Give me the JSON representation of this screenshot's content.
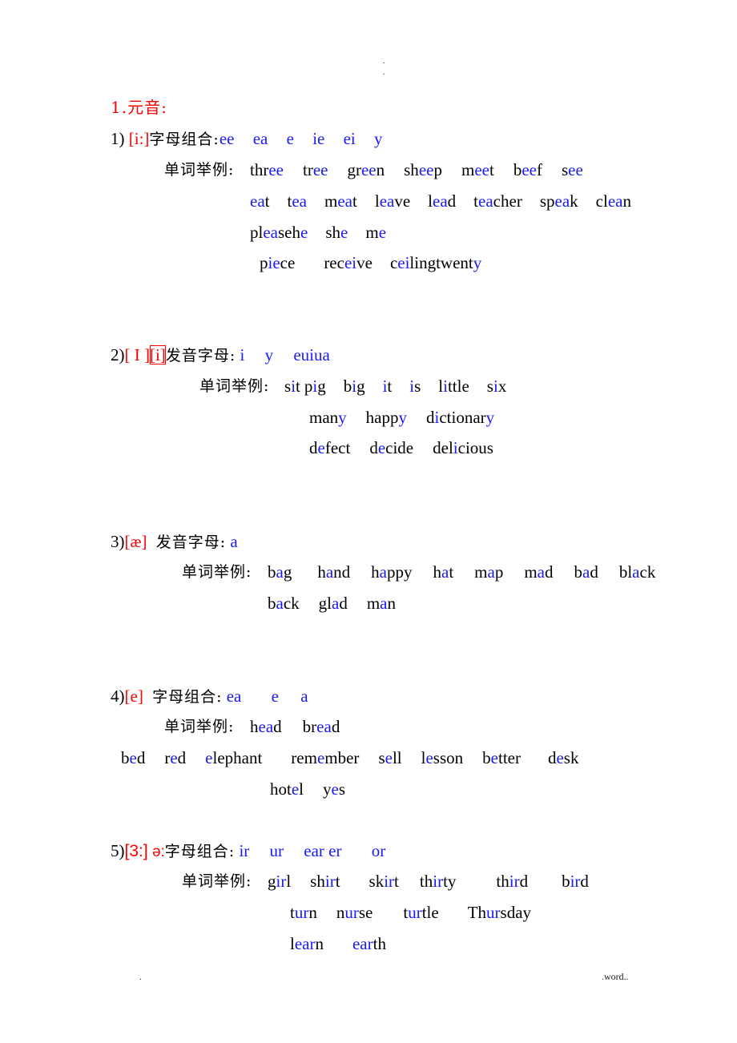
{
  "header_marks": [
    ".",
    "."
  ],
  "title": "1.元音:",
  "colors": {
    "accent_red": "#ff0000",
    "accent_blue": "#1a1aff",
    "text": "#000000"
  },
  "sections": [
    {
      "num": "1)",
      "phonetic": "[i:]",
      "phonetic_extra": "",
      "rule_label": "字母组合:",
      "letters": [
        "ee",
        "ea",
        "e",
        "ie",
        "ei",
        "y"
      ],
      "examples_label": "单词举例:",
      "rows": [
        [
          [
            [
              "thr",
              "k"
            ],
            [
              "ee",
              "b"
            ]
          ],
          [
            [
              "tr",
              "k"
            ],
            [
              "ee",
              "b"
            ]
          ],
          [
            [
              "gr",
              "k"
            ],
            [
              "ee",
              "b"
            ],
            [
              "n",
              "k"
            ]
          ],
          [
            [
              "sh",
              "k"
            ],
            [
              "ee",
              "b"
            ],
            [
              "p",
              "k"
            ]
          ],
          [
            [
              "m",
              "k"
            ],
            [
              "ee",
              "b"
            ],
            [
              "t",
              "k"
            ]
          ],
          [
            [
              "b",
              "k"
            ],
            [
              "ee",
              "b"
            ],
            [
              "f",
              "k"
            ]
          ],
          [
            [
              "s",
              "k"
            ],
            [
              "ee",
              "b"
            ]
          ]
        ],
        [
          [
            [
              "ea",
              "b"
            ],
            [
              "t",
              "k"
            ]
          ],
          [
            [
              "t",
              "k"
            ],
            [
              "ea",
              "b"
            ]
          ],
          [
            [
              "m",
              "k"
            ],
            [
              "ea",
              "b"
            ],
            [
              "t",
              "k"
            ]
          ],
          [
            [
              "l",
              "k"
            ],
            [
              "ea",
              "b"
            ],
            [
              "ve",
              "k"
            ]
          ],
          [
            [
              "l",
              "k"
            ],
            [
              "ea",
              "b"
            ],
            [
              "d",
              "k"
            ]
          ],
          [
            [
              "t",
              "k"
            ],
            [
              "ea",
              "b"
            ],
            [
              "cher",
              "k"
            ]
          ],
          [
            [
              "sp",
              "k"
            ],
            [
              "ea",
              "b"
            ],
            [
              "k",
              "k"
            ]
          ],
          [
            [
              "cl",
              "k"
            ],
            [
              "ea",
              "b"
            ],
            [
              "n",
              "k"
            ]
          ]
        ],
        [
          [
            [
              "pl",
              "k"
            ],
            [
              "ea",
              "b"
            ],
            [
              "seh",
              "k"
            ],
            [
              "e",
              "b"
            ]
          ],
          [
            [
              "sh",
              "k"
            ],
            [
              "e",
              "b"
            ]
          ],
          [
            [
              "m",
              "k"
            ],
            [
              "e",
              "b"
            ]
          ]
        ],
        [
          [
            [
              "p",
              "k"
            ],
            [
              "ie",
              "b"
            ],
            [
              "ce",
              "k"
            ]
          ],
          [
            [
              "rec",
              "k"
            ],
            [
              "ei",
              "b"
            ],
            [
              "ve",
              "k"
            ]
          ],
          [
            [
              "c",
              "k"
            ],
            [
              "ei",
              "b"
            ],
            [
              "ling",
              "k"
            ]
          ],
          [
            [
              "twent",
              "k"
            ],
            [
              "y",
              "b"
            ]
          ]
        ]
      ]
    },
    {
      "num": "2)",
      "phonetic": "[ I ]",
      "phonetic_extra": "[i]",
      "rule_label": "发音字母:",
      "letters": [
        "i",
        "y",
        "euiua"
      ],
      "examples_label": "单词举例:",
      "rows": [
        [
          [
            [
              "s",
              "k"
            ],
            [
              "i",
              "b"
            ],
            [
              "t",
              "k"
            ]
          ],
          [
            [
              "p",
              "k"
            ],
            [
              "i",
              "b"
            ],
            [
              "g",
              "k"
            ]
          ],
          [
            [
              "b",
              "k"
            ],
            [
              "i",
              "b"
            ],
            [
              "g",
              "k"
            ]
          ],
          [
            [
              "i",
              "b"
            ],
            [
              "t",
              "k"
            ]
          ],
          [
            [
              "i",
              "b"
            ],
            [
              "s",
              "k"
            ]
          ],
          [
            [
              "l",
              "k"
            ],
            [
              "i",
              "b"
            ],
            [
              "ttle",
              "k"
            ]
          ],
          [
            [
              "s",
              "k"
            ],
            [
              "i",
              "b"
            ],
            [
              "x",
              "k"
            ]
          ]
        ],
        [
          [
            [
              "man",
              "k"
            ],
            [
              "y",
              "b"
            ]
          ],
          [
            [
              "happ",
              "k"
            ],
            [
              "y",
              "b"
            ]
          ],
          [
            [
              "d",
              "k"
            ],
            [
              "i",
              "b"
            ],
            [
              "ctionar",
              "k"
            ],
            [
              "y",
              "b"
            ]
          ]
        ],
        [
          [
            [
              "d",
              "k"
            ],
            [
              "e",
              "b"
            ],
            [
              "fect",
              "k"
            ]
          ],
          [
            [
              "d",
              "k"
            ],
            [
              "e",
              "b"
            ],
            [
              "cide",
              "k"
            ]
          ],
          [
            [
              "del",
              "k"
            ],
            [
              "i",
              "b"
            ],
            [
              "cious",
              "k"
            ]
          ]
        ]
      ]
    },
    {
      "num": "3)",
      "phonetic": "[æ]",
      "phonetic_extra": "",
      "rule_label": "发音字母:",
      "letters": [
        "a"
      ],
      "examples_label": "单词举例:",
      "rows": [
        [
          [
            [
              "b",
              "k"
            ],
            [
              "a",
              "b"
            ],
            [
              "g",
              "k"
            ]
          ],
          [
            [
              "h",
              "k"
            ],
            [
              "a",
              "b"
            ],
            [
              "nd",
              "k"
            ]
          ],
          [
            [
              "h",
              "k"
            ],
            [
              "a",
              "b"
            ],
            [
              "ppy",
              "k"
            ]
          ],
          [
            [
              "h",
              "k"
            ],
            [
              "a",
              "b"
            ],
            [
              "t",
              "k"
            ]
          ],
          [
            [
              "m",
              "k"
            ],
            [
              "a",
              "b"
            ],
            [
              "p",
              "k"
            ]
          ],
          [
            [
              "m",
              "k"
            ],
            [
              "a",
              "b"
            ],
            [
              "d",
              "k"
            ]
          ],
          [
            [
              "b",
              "k"
            ],
            [
              "a",
              "b"
            ],
            [
              "d",
              "k"
            ]
          ],
          [
            [
              "bl",
              "k"
            ],
            [
              "a",
              "b"
            ],
            [
              "ck",
              "k"
            ]
          ]
        ],
        [
          [
            [
              "b",
              "k"
            ],
            [
              "a",
              "b"
            ],
            [
              "ck",
              "k"
            ]
          ],
          [
            [
              "gl",
              "k"
            ],
            [
              "a",
              "b"
            ],
            [
              "d",
              "k"
            ]
          ],
          [
            [
              "m",
              "k"
            ],
            [
              "a",
              "b"
            ],
            [
              "n",
              "k"
            ]
          ]
        ]
      ]
    },
    {
      "num": "4)",
      "phonetic": "[e]",
      "phonetic_extra": "",
      "rule_label": "字母组合:",
      "letters": [
        "ea",
        "e",
        "a"
      ],
      "examples_label": "单词举例:",
      "rows": [
        [
          [
            [
              "h",
              "k"
            ],
            [
              "ea",
              "b"
            ],
            [
              "d",
              "k"
            ]
          ],
          [
            [
              "br",
              "k"
            ],
            [
              "ea",
              "b"
            ],
            [
              "d",
              "k"
            ]
          ]
        ],
        [
          [
            [
              "b",
              "k"
            ],
            [
              "e",
              "b"
            ],
            [
              "d",
              "k"
            ]
          ],
          [
            [
              "r",
              "k"
            ],
            [
              "e",
              "b"
            ],
            [
              "d",
              "k"
            ]
          ],
          [
            [
              "e",
              "b"
            ],
            [
              "lephant",
              "k"
            ]
          ],
          [
            [
              "rem",
              "k"
            ],
            [
              "e",
              "b"
            ],
            [
              "mber",
              "k"
            ]
          ],
          [
            [
              "s",
              "k"
            ],
            [
              "e",
              "b"
            ],
            [
              "ll",
              "k"
            ]
          ],
          [
            [
              "l",
              "k"
            ],
            [
              "e",
              "b"
            ],
            [
              "sson",
              "k"
            ]
          ],
          [
            [
              "b",
              "k"
            ],
            [
              "e",
              "b"
            ],
            [
              "tter",
              "k"
            ]
          ],
          [
            [
              "d",
              "k"
            ],
            [
              "e",
              "b"
            ],
            [
              "sk",
              "k"
            ]
          ]
        ],
        [
          [
            [
              "hot",
              "k"
            ],
            [
              "e",
              "b"
            ],
            [
              "l",
              "k"
            ]
          ],
          [
            [
              "y",
              "k"
            ],
            [
              "e",
              "b"
            ],
            [
              "s",
              "k"
            ]
          ]
        ]
      ]
    },
    {
      "num": "5)",
      "phonetic": "[3:]",
      "phonetic_extra": "ə:",
      "rule_label": "字母组合:",
      "letters": [
        "ir",
        "ur",
        "ear er",
        "or"
      ],
      "examples_label": "单词举例:",
      "rows": [
        [
          [
            [
              "g",
              "k"
            ],
            [
              "ir",
              "b"
            ],
            [
              "l",
              "k"
            ]
          ],
          [
            [
              "sh",
              "k"
            ],
            [
              "ir",
              "b"
            ],
            [
              "t",
              "k"
            ]
          ],
          [
            [
              "sk",
              "k"
            ],
            [
              "ir",
              "b"
            ],
            [
              "t",
              "k"
            ]
          ],
          [
            [
              "th",
              "k"
            ],
            [
              "ir",
              "b"
            ],
            [
              "ty",
              "k"
            ]
          ],
          [
            [
              "th",
              "k"
            ],
            [
              "ir",
              "b"
            ],
            [
              "d",
              "k"
            ]
          ],
          [
            [
              "b",
              "k"
            ],
            [
              "ir",
              "b"
            ],
            [
              "d",
              "k"
            ]
          ]
        ],
        [
          [
            [
              "t",
              "k"
            ],
            [
              "ur",
              "b"
            ],
            [
              "n",
              "k"
            ]
          ],
          [
            [
              "n",
              "k"
            ],
            [
              "ur",
              "b"
            ],
            [
              "se",
              "k"
            ]
          ],
          [
            [
              "t",
              "k"
            ],
            [
              "ur",
              "b"
            ],
            [
              "tle",
              "k"
            ]
          ],
          [
            [
              "Th",
              "k"
            ],
            [
              "ur",
              "b"
            ],
            [
              "sday",
              "k"
            ]
          ]
        ],
        [
          [
            [
              "l",
              "k"
            ],
            [
              "ear",
              "b"
            ],
            [
              "n",
              "k"
            ]
          ],
          [
            [
              "ear",
              "b"
            ],
            [
              "th",
              "k"
            ]
          ]
        ]
      ]
    }
  ],
  "footer": {
    "left": ".",
    "right": ".word.."
  }
}
